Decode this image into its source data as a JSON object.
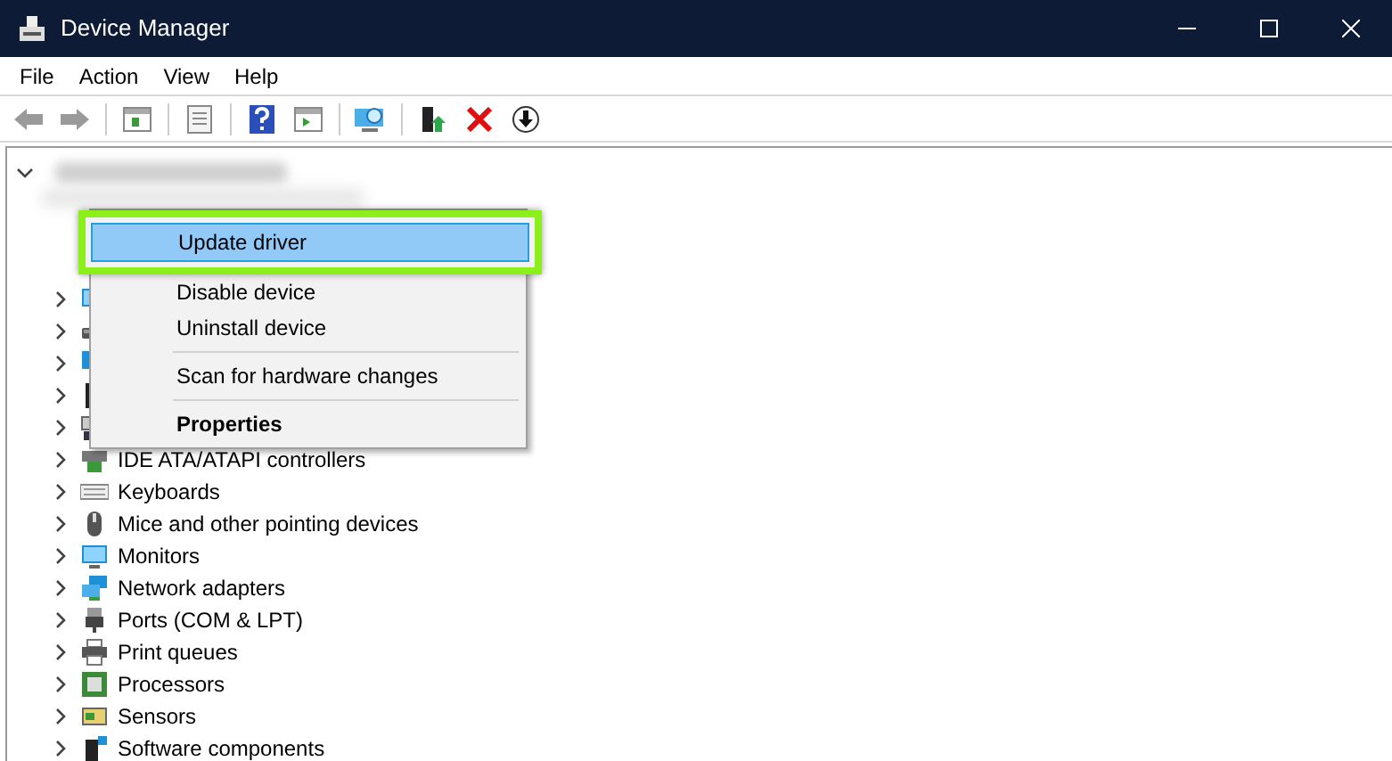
{
  "window": {
    "title": "Device Manager"
  },
  "menu_bar": [
    "File",
    "Action",
    "View",
    "Help"
  ],
  "tree": {
    "expanded": true,
    "children": [
      {
        "kind": "monitor",
        "expanded": false
      },
      {
        "kind": "disk",
        "expanded": false
      },
      {
        "kind": "display",
        "expanded": false
      },
      {
        "kind": "chip",
        "expanded": false
      },
      {
        "kind": "hid",
        "expanded": false
      },
      {
        "kind": "ide",
        "label": "IDE ATA/ATAPI controllers",
        "expanded": false
      },
      {
        "kind": "keyboard",
        "label": "Keyboards",
        "expanded": false
      },
      {
        "kind": "mouse",
        "label": "Mice and other pointing devices",
        "expanded": false
      },
      {
        "kind": "monitor",
        "label": "Monitors",
        "expanded": false
      },
      {
        "kind": "network",
        "label": "Network adapters",
        "expanded": false
      },
      {
        "kind": "port",
        "label": "Ports (COM & LPT)",
        "expanded": false
      },
      {
        "kind": "printer",
        "label": "Print queues",
        "expanded": false
      },
      {
        "kind": "cpu",
        "label": "Processors",
        "expanded": false
      },
      {
        "kind": "sensor",
        "label": "Sensors",
        "expanded": false
      },
      {
        "kind": "software",
        "label": "Software components",
        "expanded": false
      }
    ]
  },
  "context_menu": {
    "items": [
      {
        "kind": "item",
        "label": "Update driver",
        "selected": true,
        "highlighted": true
      },
      {
        "kind": "item",
        "label": "Disable device",
        "selected": false,
        "highlighted": false
      },
      {
        "kind": "item",
        "label": "Uninstall device",
        "selected": false,
        "highlighted": false
      },
      {
        "kind": "separator"
      },
      {
        "kind": "item",
        "label": "Scan for hardware changes",
        "selected": false,
        "highlighted": false
      },
      {
        "kind": "separator"
      },
      {
        "kind": "bold",
        "label": "Properties",
        "selected": false,
        "highlighted": false
      }
    ]
  }
}
